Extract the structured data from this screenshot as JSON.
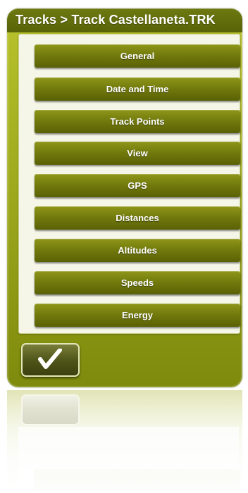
{
  "header": {
    "title": "Tracks > Track Castellaneta.TRK"
  },
  "menu": {
    "items": [
      {
        "label": "General"
      },
      {
        "label": "Date and Time"
      },
      {
        "label": "Track Points"
      },
      {
        "label": "View"
      },
      {
        "label": "GPS"
      },
      {
        "label": "Distances"
      },
      {
        "label": "Altitudes"
      },
      {
        "label": "Speeds"
      },
      {
        "label": "Energy"
      }
    ]
  },
  "footer": {
    "ok_icon": "checkmark-icon"
  },
  "colors": {
    "panel": "#9aa51b",
    "titlebar": "#586308",
    "button": "#737b0d",
    "content_bg": "#f5f6e8",
    "text": "#ffffff"
  }
}
